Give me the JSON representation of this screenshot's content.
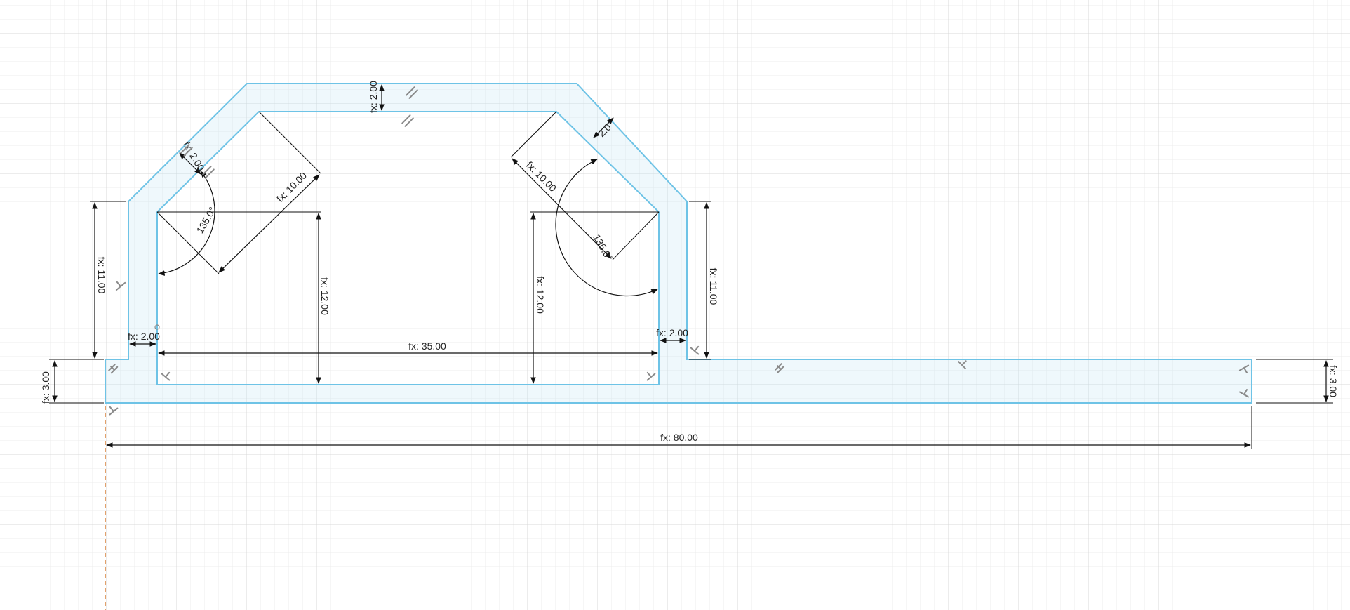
{
  "dimensions": {
    "total_width": "fx: 80.00",
    "inner_width": "fx: 35.00",
    "left_height": "fx: 11.00",
    "right_height": "fx: 11.00",
    "left_inner_height": "fx: 12.00",
    "right_inner_height": "fx: 12.00",
    "left_slant": "fx: 10.00",
    "right_slant": "fx: 10.00",
    "left_angle": "135.0°",
    "right_angle": "135.0°",
    "left_wall": "fx: 2.00",
    "right_wall": "fx: 2.00",
    "top_thickness": "fx: 2.00",
    "left_diag_offset": "fx: 2.00",
    "right_diag_offset": "2.0°",
    "left_flange": "fx: 3.00",
    "right_flange": "fx: 3.00"
  },
  "colors": {
    "profile_stroke": "#6ec3e6",
    "profile_fill": "#bee4f5",
    "grid_minor": "#ececec",
    "grid_major": "#d9d9d9",
    "origin_axis": "#d9823b"
  },
  "icons": [
    "perpendicular-icon",
    "parallel-icon",
    "coincident-icon"
  ]
}
